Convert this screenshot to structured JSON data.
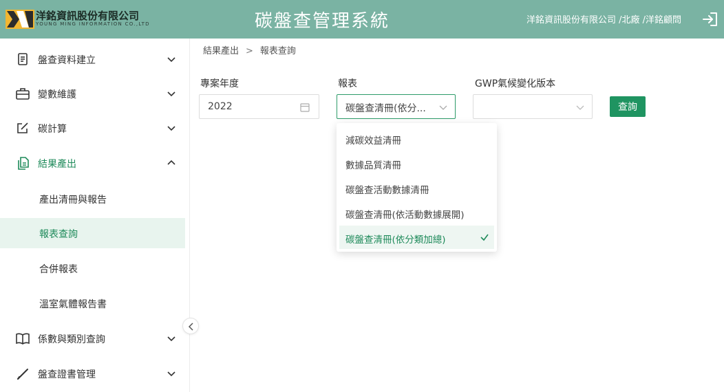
{
  "header": {
    "logo_cn": "洋銘資訊股份有限公司",
    "logo_en": "YOUNG MING INFORMATION CO.,LTD",
    "app_title": "碳盤查管理系統",
    "user_info": "洋銘資訊股份有限公司 /北廠 /洋銘顧問",
    "logout_icon": "logout-icon"
  },
  "sidebar": {
    "items": [
      {
        "label": "盤查資料建立",
        "icon": "document-icon"
      },
      {
        "label": "變數維護",
        "icon": "briefcase-icon"
      },
      {
        "label": "碳計算",
        "icon": "edit-icon"
      },
      {
        "label": "結果產出",
        "icon": "files-icon"
      },
      {
        "label": "係數與類別查詢",
        "icon": "book-icon"
      },
      {
        "label": "盤查證書管理",
        "icon": "pen-icon"
      }
    ],
    "sub_items": [
      {
        "label": "產出清冊與報告"
      },
      {
        "label": "報表查詢"
      },
      {
        "label": "合併報表"
      },
      {
        "label": "溫室氣體報告書"
      }
    ]
  },
  "breadcrumb": {
    "parent": "結果產出",
    "separator": ">",
    "current": "報表查詢"
  },
  "form": {
    "year_label": "專案年度",
    "year_value": "2022",
    "report_label": "報表",
    "report_value": "碳盤查清冊(依分...",
    "gwp_label": "GWP氣候變化版本",
    "gwp_value": "",
    "query_button": "查詢"
  },
  "dropdown": {
    "options": [
      "減碳效益清冊",
      "數據品質清冊",
      "碳盤查活動數據清冊",
      "碳盤查清冊(依活動數據展開)",
      "碳盤查清冊(依分類加總)"
    ],
    "selected_index": 4
  },
  "colors": {
    "header_bg": "#7ab3a3",
    "accent": "#1f9461",
    "active_bg": "#e8f4ee"
  }
}
